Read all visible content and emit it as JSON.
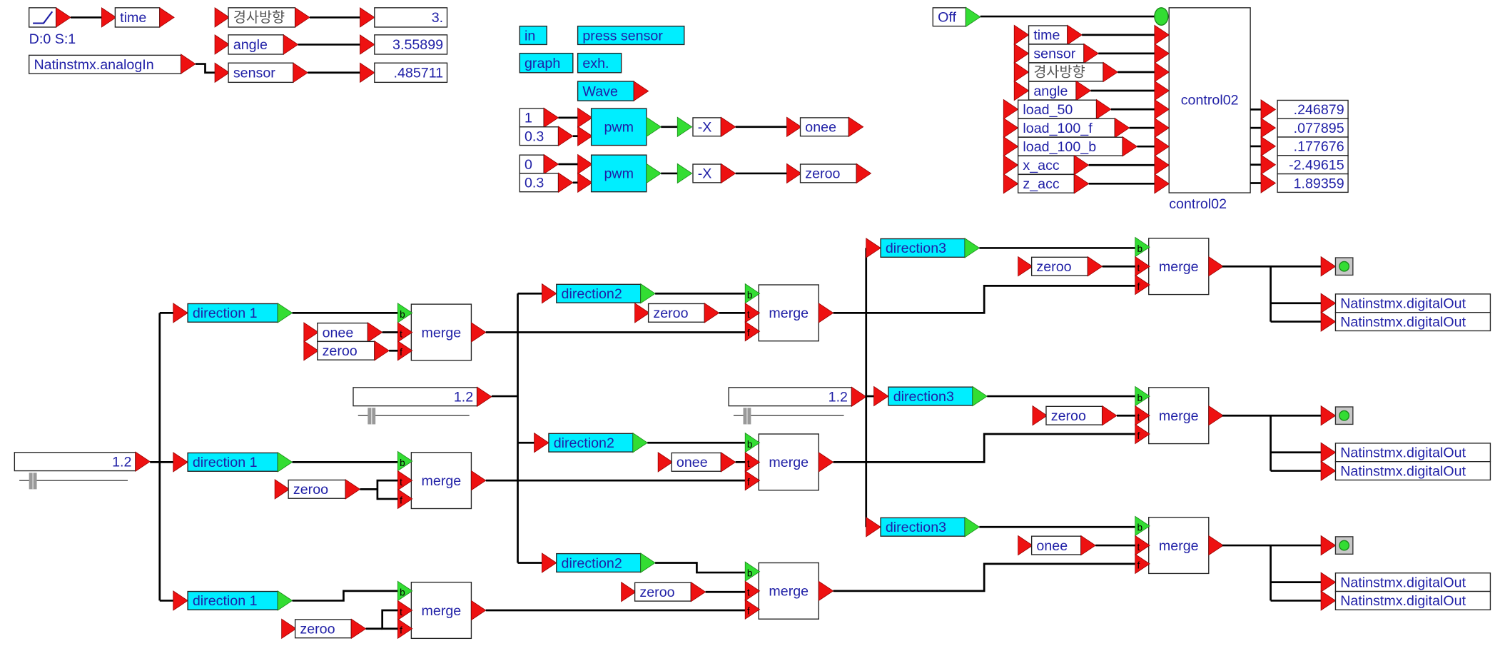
{
  "colors": {
    "port_red": "#ee1111",
    "port_green": "#33dd33",
    "block_cyan": "#00eeff",
    "text_blue": "#1f1fa6",
    "wire": "#000000"
  },
  "top_left": {
    "ramp_label": "D:0 S:1",
    "time": "time",
    "korean": "경사방향",
    "angle": "angle",
    "analog_in": "Natinstmx.analogIn",
    "sensor": "sensor",
    "values": {
      "korean": "3.",
      "angle": "3.55899",
      "sensor": ".485711"
    }
  },
  "labels": {
    "in": "in",
    "press_sensor": "press sensor",
    "graph": "graph",
    "exh": "exh.",
    "wave": "Wave"
  },
  "pwm": [
    {
      "inputs": [
        "1",
        "0.3"
      ],
      "block": "pwm",
      "negate": "-X",
      "output": "onee"
    },
    {
      "inputs": [
        "0",
        "0.3"
      ],
      "block": "pwm",
      "negate": "-X",
      "output": "zeroo"
    }
  ],
  "control": {
    "switch": "Off",
    "block": "control02",
    "caption": "control02",
    "inputs": [
      "time",
      "sensor",
      "경사방향",
      "angle",
      "load_50",
      "load_100_f",
      "load_100_b",
      "x_acc",
      "z_acc"
    ],
    "outputs": [
      ".246879",
      ".077895",
      ".177676",
      "-2.49615",
      "1.89359"
    ]
  },
  "tree": {
    "sliders": [
      "1.2",
      "1.2",
      "1.2"
    ],
    "merge_label": "merge",
    "port_labels": [
      "b",
      "t",
      "f"
    ],
    "level1": [
      {
        "direction": "direction 1",
        "inputs": [
          "onee",
          "zeroo"
        ]
      },
      {
        "direction": "direction 1",
        "inputs": [
          "zeroo"
        ]
      },
      {
        "direction": "direction 1",
        "inputs": [
          "zeroo"
        ]
      }
    ],
    "level2": [
      {
        "direction": "direction2",
        "input": "zeroo"
      },
      {
        "direction": "direction2",
        "input": "onee"
      },
      {
        "direction": "direction2",
        "input": "zeroo"
      }
    ],
    "level3": [
      {
        "direction": "direction3",
        "input": "zeroo"
      },
      {
        "direction": "direction3",
        "input": "zeroo"
      },
      {
        "direction": "direction3",
        "input": "onee"
      }
    ],
    "outputs": [
      "Natinstmx.digitalOut",
      "Natinstmx.digitalOut"
    ]
  }
}
